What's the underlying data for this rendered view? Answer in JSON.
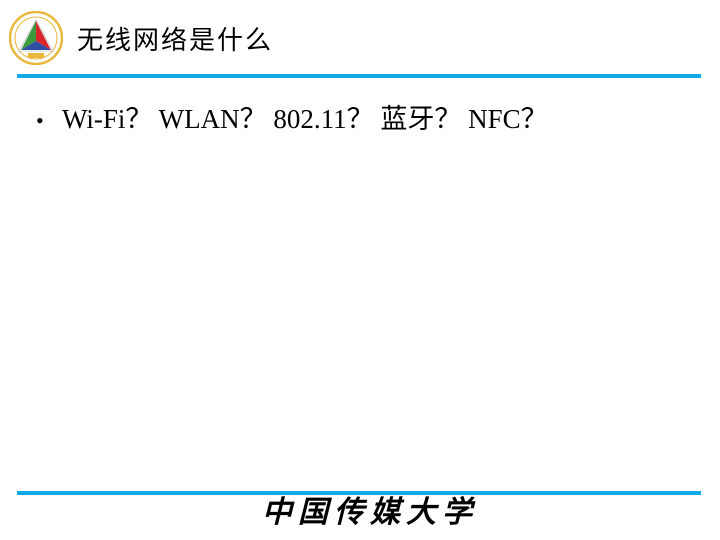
{
  "header": {
    "title": "无线网络是什么",
    "logo_icon": "university-emblem-icon"
  },
  "content": {
    "bullets": [
      {
        "text": "Wi-Fi？ WLAN？ 802.11？ 蓝牙？ NFC？"
      }
    ],
    "bullet_glyph": "•"
  },
  "footer": {
    "calligraphy": "中国传媒大学"
  },
  "colors": {
    "accent_rule": "#12a9e8",
    "emblem_gold": "#e8b83c",
    "emblem_red": "#d8262c",
    "emblem_blue": "#2d4ea3",
    "emblem_green": "#3b9a3e"
  }
}
